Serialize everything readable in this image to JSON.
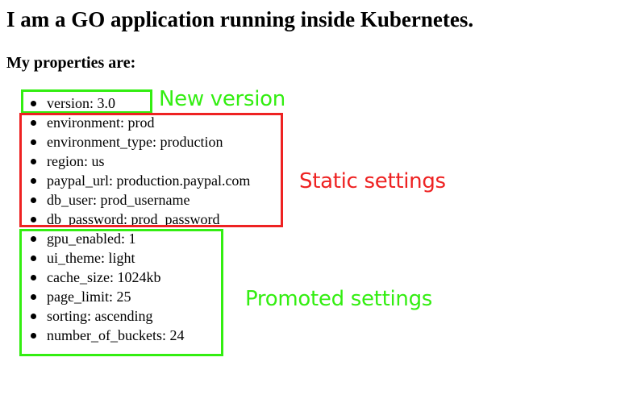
{
  "page": {
    "title": "I am a GO application running inside Kubernetes.",
    "subtitle": "My properties are:"
  },
  "properties": [
    {
      "text": "version: 3.0"
    },
    {
      "text": "environment: prod"
    },
    {
      "text": "environment_type: production"
    },
    {
      "text": "region: us"
    },
    {
      "text": "paypal_url: production.paypal.com"
    },
    {
      "text": "db_user: prod_username"
    },
    {
      "text": "db_password: prod_password"
    },
    {
      "text": "gpu_enabled: 1"
    },
    {
      "text": "ui_theme: light"
    },
    {
      "text": "cache_size: 1024kb"
    },
    {
      "text": "page_limit: 25"
    },
    {
      "text": "sorting: ascending"
    },
    {
      "text": "number_of_buckets: 24"
    }
  ],
  "annotations": {
    "new_version": {
      "label": "New version",
      "color": "#33ee11"
    },
    "static_settings": {
      "label": "Static settings",
      "color": "#ee2222"
    },
    "promoted_settings": {
      "label": "Promoted settings",
      "color": "#33ee11"
    }
  }
}
